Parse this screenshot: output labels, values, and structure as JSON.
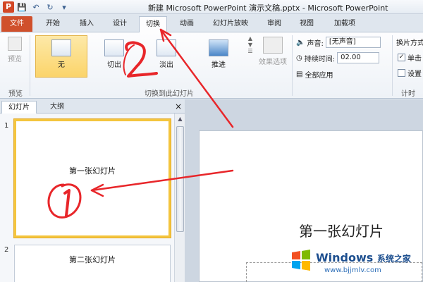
{
  "titlebar": {
    "app_icon": "P",
    "title": "新建 Microsoft PowerPoint 演示文稿.pptx - Microsoft PowerPoint",
    "qat_icons": [
      "save-icon",
      "undo-icon",
      "redo-icon",
      "customize-icon"
    ]
  },
  "tabs": [
    "文件",
    "开始",
    "插入",
    "设计",
    "切换",
    "动画",
    "幻灯片放映",
    "审阅",
    "视图",
    "加载项"
  ],
  "active_tab": "切换",
  "ribbon": {
    "preview_label": "预览",
    "preview_group": "预览",
    "transitions": [
      {
        "label": "无",
        "selected": true
      },
      {
        "label": "切出",
        "selected": false
      },
      {
        "label": "淡出",
        "selected": false
      },
      {
        "label": "推进",
        "selected": false
      }
    ],
    "effect_options": "效果选项",
    "transition_group": "切换到此幻灯片",
    "sound_label": "声音:",
    "sound_value": "[无声音]",
    "duration_label": "持续时间:",
    "duration_value": "02.00",
    "apply_all": "全部应用",
    "advance_label": "换片方式",
    "on_click": "单击",
    "on_click_checked": true,
    "set_label": "设置",
    "set_checked": false,
    "timing_group": "计时"
  },
  "pane": {
    "tab_slides": "幻灯片",
    "tab_outline": "大纲",
    "close": "×"
  },
  "slides": [
    {
      "num": "1",
      "title": "第一张幻灯片",
      "selected": true
    },
    {
      "num": "2",
      "title": "第二张幻灯片",
      "selected": false
    }
  ],
  "main": {
    "title": "第一张幻灯片"
  },
  "annotations": {
    "colors": {
      "marker": "#e8262a"
    }
  },
  "watermark": {
    "brand": "Windows",
    "brand_cn": "系统之家",
    "url": "www.bjjmlv.com",
    "logo_colors": [
      "#f25022",
      "#7fba00",
      "#00a4ef",
      "#ffb900"
    ]
  }
}
